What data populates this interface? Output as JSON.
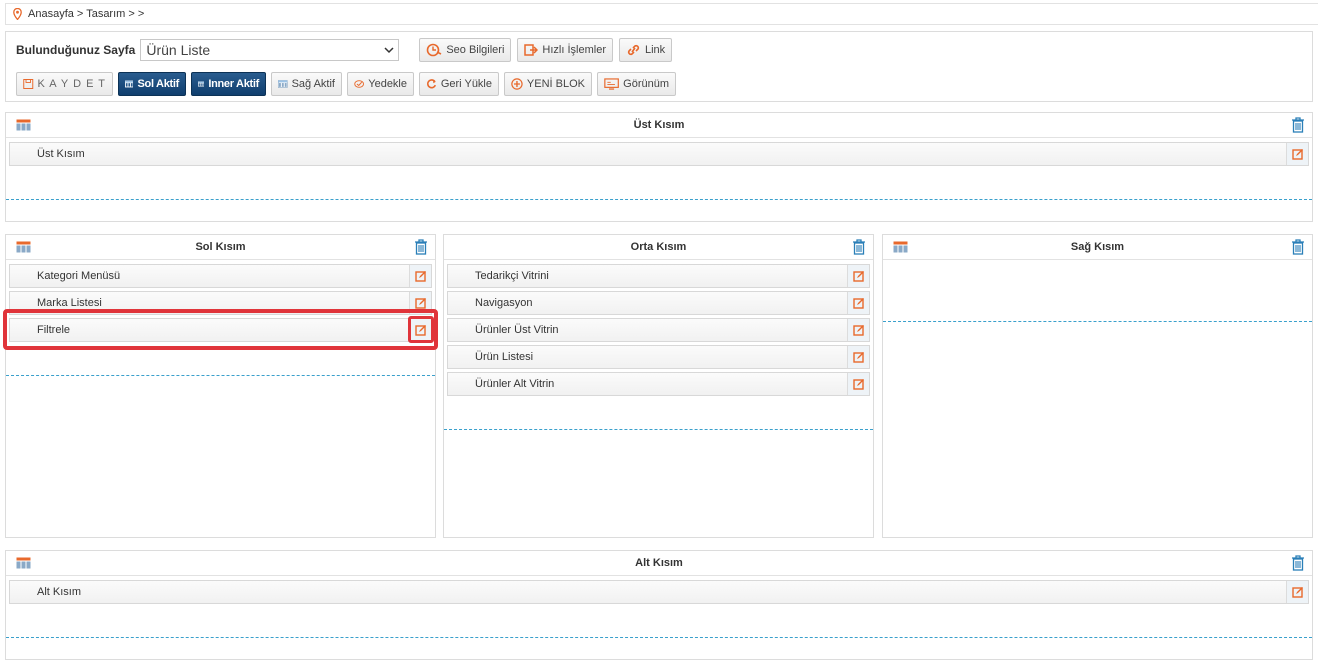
{
  "breadcrumb": {
    "text": "Anasayfa > Tasarım >  >"
  },
  "toolbar": {
    "page_label": "Bulunduğunuz Sayfa",
    "page_select_value": "Ürün Liste",
    "seo_label": "Seo Bilgileri",
    "quick_label": "Hızlı İşlemler",
    "link_label": "Link",
    "save_label": "K A Y D E T",
    "left_active_label": "Sol Aktif",
    "inner_active_label": "Inner Aktif",
    "right_active_label": "Sağ Aktif",
    "backup_label": "Yedekle",
    "restore_label": "Geri Yükle",
    "new_block_label": "YENİ BLOK",
    "view_label": "Görünüm"
  },
  "sections": {
    "top": {
      "title": "Üst Kısım",
      "items": [
        "Üst Kısım"
      ]
    },
    "left": {
      "title": "Sol Kısım",
      "items": [
        "Kategori Menüsü",
        "Marka Listesi",
        "Filtrele"
      ]
    },
    "middle": {
      "title": "Orta Kısım",
      "items": [
        "Tedarikçi Vitrini",
        "Navigasyon",
        "Ürünler Üst Vitrin",
        "Ürün Listesi",
        "Ürünler Alt Vitrin"
      ]
    },
    "right": {
      "title": "Sağ Kısım",
      "items": []
    },
    "bottom": {
      "title": "Alt Kısım",
      "items": [
        "Alt Kısım"
      ]
    }
  },
  "colors": {
    "accent_orange": "#e8692c",
    "dark_blue": "#0f3e6e",
    "dash_blue": "#3aa0cc",
    "highlight_red": "#e0343a"
  },
  "icons": [
    "location-pin-icon",
    "chevron-down-icon",
    "seo-icon",
    "export-icon",
    "link-icon",
    "save-icon",
    "layout-icon",
    "backup-icon",
    "refresh-icon",
    "plus-circle-icon",
    "monitor-icon",
    "grid-icon",
    "trash-icon",
    "edit-icon"
  ]
}
